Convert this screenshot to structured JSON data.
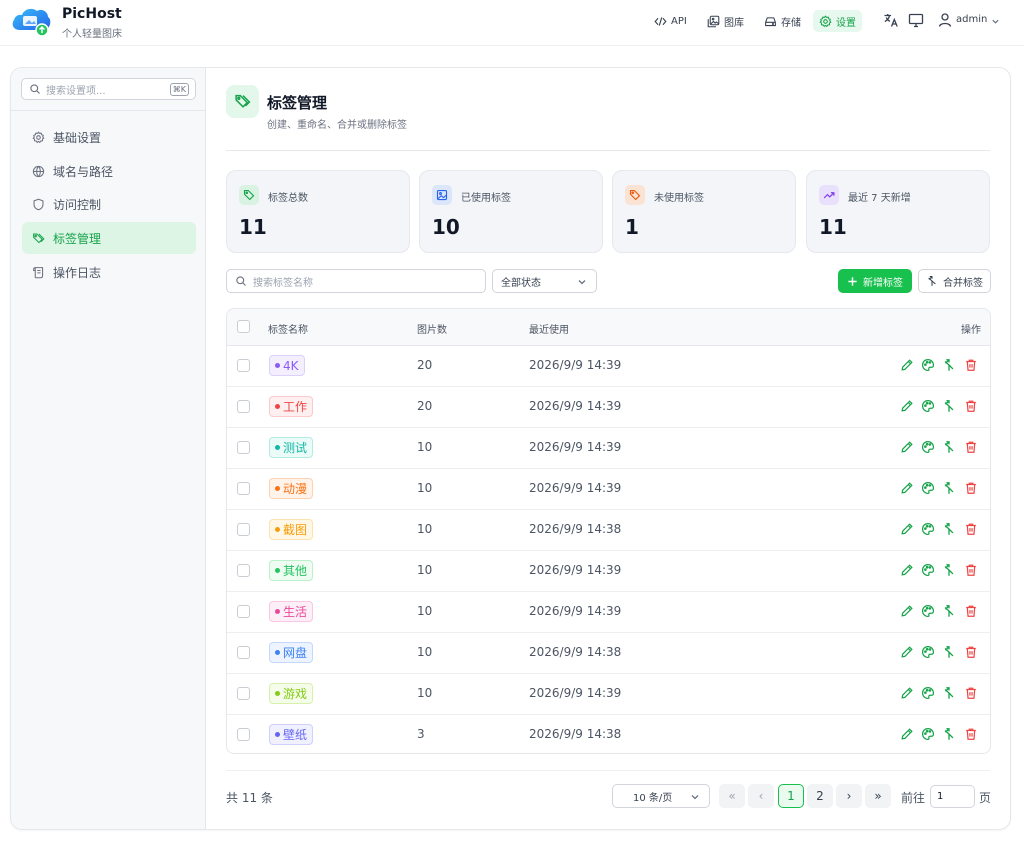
{
  "app": {
    "name": "PicHost",
    "subtitle": "个人轻量图床"
  },
  "topnav": [
    {
      "label": "API",
      "icon": "code-icon"
    },
    {
      "label": "图库",
      "icon": "images-icon"
    },
    {
      "label": "存储",
      "icon": "hard-drive-icon"
    },
    {
      "label": "设置",
      "icon": "gear-icon",
      "active": true
    }
  ],
  "user": {
    "name": "admin"
  },
  "sidebar": {
    "search_placeholder": "搜索设置项...",
    "shortcut": "⌘K",
    "items": [
      {
        "label": "基础设置",
        "icon": "gear-icon"
      },
      {
        "label": "域名与路径",
        "icon": "globe-icon"
      },
      {
        "label": "访问控制",
        "icon": "shield-icon"
      },
      {
        "label": "标签管理",
        "icon": "tag-icon",
        "active": true
      },
      {
        "label": "操作日志",
        "icon": "scroll-icon"
      }
    ]
  },
  "page": {
    "title": "标签管理",
    "subtitle": "创建、重命名、合并或删除标签"
  },
  "stats": [
    {
      "label": "标签总数",
      "value": "11",
      "icon": "tag-icon",
      "color": "#16a34a",
      "bg": "#d9f3e2"
    },
    {
      "label": "已使用标签",
      "value": "10",
      "icon": "image-icon",
      "color": "#2563eb",
      "bg": "#dbe6fb"
    },
    {
      "label": "未使用标签",
      "value": "1",
      "icon": "tag-icon",
      "color": "#ea580c",
      "bg": "#fbe3d3"
    },
    {
      "label": "最近 7 天新增",
      "value": "11",
      "icon": "trending-up-icon",
      "color": "#7c3aed",
      "bg": "#e9e1fb"
    }
  ],
  "toolbar": {
    "search_placeholder": "搜索标签名称",
    "status_filter": "全部状态",
    "new_label": "新增标签",
    "merge_label": "合并标签"
  },
  "table": {
    "columns": [
      "标签名称",
      "图片数",
      "最近使用",
      "操作"
    ],
    "rows": [
      {
        "name": "4K",
        "count": "20",
        "last_used": "2026/9/9 14:39",
        "color": "#8b5cf6",
        "bg": "#f3efff",
        "border": "#ddd1fc"
      },
      {
        "name": "工作",
        "count": "20",
        "last_used": "2026/9/9 14:39",
        "color": "#ef4444",
        "bg": "#fef0f0",
        "border": "#fbcaca"
      },
      {
        "name": "测试",
        "count": "10",
        "last_used": "2026/9/9 14:39",
        "color": "#14b8a6",
        "bg": "#ebfbf8",
        "border": "#b5ebe2"
      },
      {
        "name": "动漫",
        "count": "10",
        "last_used": "2026/9/9 14:39",
        "color": "#f97316",
        "bg": "#fff3ea",
        "border": "#fdd2b3"
      },
      {
        "name": "截图",
        "count": "10",
        "last_used": "2026/9/9 14:38",
        "color": "#f59e0b",
        "bg": "#fff7e6",
        "border": "#fce2ac"
      },
      {
        "name": "其他",
        "count": "10",
        "last_used": "2026/9/9 14:39",
        "color": "#22c55e",
        "bg": "#eefcf2",
        "border": "#bcefcc"
      },
      {
        "name": "生活",
        "count": "10",
        "last_used": "2026/9/9 14:39",
        "color": "#ec4899",
        "bg": "#fdeff7",
        "border": "#f9c7e1"
      },
      {
        "name": "网盘",
        "count": "10",
        "last_used": "2026/9/9 14:38",
        "color": "#3b82f6",
        "bg": "#eef4ff",
        "border": "#c4d8fc"
      },
      {
        "name": "游戏",
        "count": "10",
        "last_used": "2026/9/9 14:39",
        "color": "#84cc16",
        "bg": "#f5fce9",
        "border": "#d8f0ae"
      },
      {
        "name": "壁纸",
        "count": "3",
        "last_used": "2026/9/9 14:38",
        "color": "#6366f1",
        "bg": "#f0f0ff",
        "border": "#cfd0fb"
      }
    ]
  },
  "footer": {
    "total": "共 11 条",
    "page_size": "10 条/页",
    "first": "«",
    "prev": "‹",
    "pages": [
      "1",
      "2"
    ],
    "current_page": "1",
    "next": "›",
    "last": "»",
    "goto_label": "前往",
    "goto_value": "1",
    "page_suffix": "页"
  },
  "colors": {
    "accent": "#18c04e",
    "danger": "#ef4444"
  }
}
